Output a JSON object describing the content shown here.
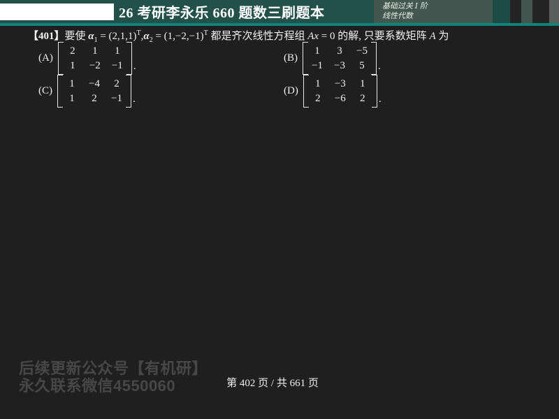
{
  "header": {
    "title": "26 考研李永乐 660 题数三刷题本",
    "stage_line1": "基础过关 Ⅰ 阶",
    "stage_line2": "线性代数"
  },
  "question": {
    "number": "【401】",
    "pre": "要使 ",
    "alpha": "α",
    "sub1": "1",
    "eq1": " = (2,1,1)",
    "sup_t1": "T",
    "sep1": ",",
    "sub2": "2",
    "eq2": " = (1,−2,−1)",
    "sup_t2": "T",
    "mid1": " 都是齐次线性方程组 ",
    "ax_var": "Ax",
    "eq_zero": " = 0",
    "mid2": " 的解, 只要系数矩阵 ",
    "a_var": "A",
    "tail": " 为"
  },
  "options": [
    {
      "label": "(A)",
      "matrix": [
        [
          "2",
          "1",
          "1"
        ],
        [
          "1",
          "−2",
          "−1"
        ]
      ],
      "period": "."
    },
    {
      "label": "(B)",
      "matrix": [
        [
          "1",
          "3",
          "−5"
        ],
        [
          "−1",
          "−3",
          "5"
        ]
      ],
      "period": "."
    },
    {
      "label": "(C)",
      "matrix": [
        [
          "1",
          "−4",
          "2"
        ],
        [
          "1",
          "2",
          "−1"
        ]
      ],
      "period": "."
    },
    {
      "label": "(D)",
      "matrix": [
        [
          "1",
          "−3",
          "1"
        ],
        [
          "2",
          "−6",
          "2"
        ]
      ],
      "period": "."
    }
  ],
  "watermark": {
    "line1": "后续更新公众号【有机研】",
    "line2": "永久联系微信4550060"
  },
  "footer": {
    "page_text": "第 402 页 / 共 661 页"
  },
  "colors": {
    "header_bg": "#24504a",
    "stage_panel_bg": "#43564f",
    "accent_line": "#0f8478",
    "content_bg": "#1f1f1f",
    "text": "#f0f0f0",
    "watermark_text": "#474747"
  }
}
